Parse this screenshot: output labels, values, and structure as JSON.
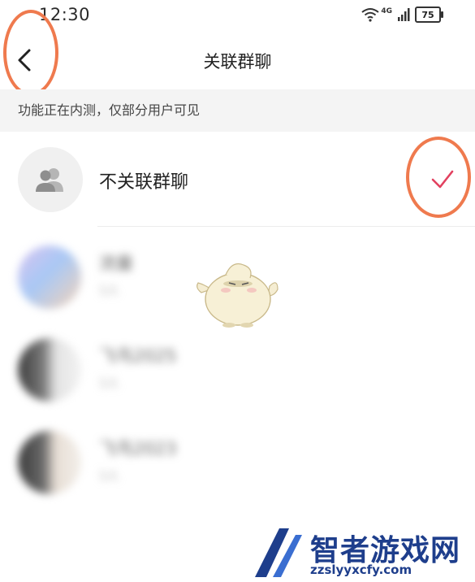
{
  "status_bar": {
    "time": "12:30",
    "network": "4G",
    "battery": "75"
  },
  "header": {
    "title": "关联群聊"
  },
  "notice": {
    "text": "功能正在内测，仅部分用户可见"
  },
  "option": {
    "label": "不关联群聊",
    "selected": true
  },
  "colors": {
    "accent": "#e2415f",
    "annotation": "#ef7a4e",
    "notice_bg": "#f4f4f4",
    "watermark": "#1e3e8c"
  },
  "groups": [
    {
      "name": "流量",
      "count": "1人"
    },
    {
      "name": "飞鸟2025",
      "count": "1人"
    },
    {
      "name": "飞鸟2023",
      "count": "1人"
    }
  ],
  "watermark": {
    "title": "智者游戏网",
    "url": "zzslyyxcfy.com"
  }
}
